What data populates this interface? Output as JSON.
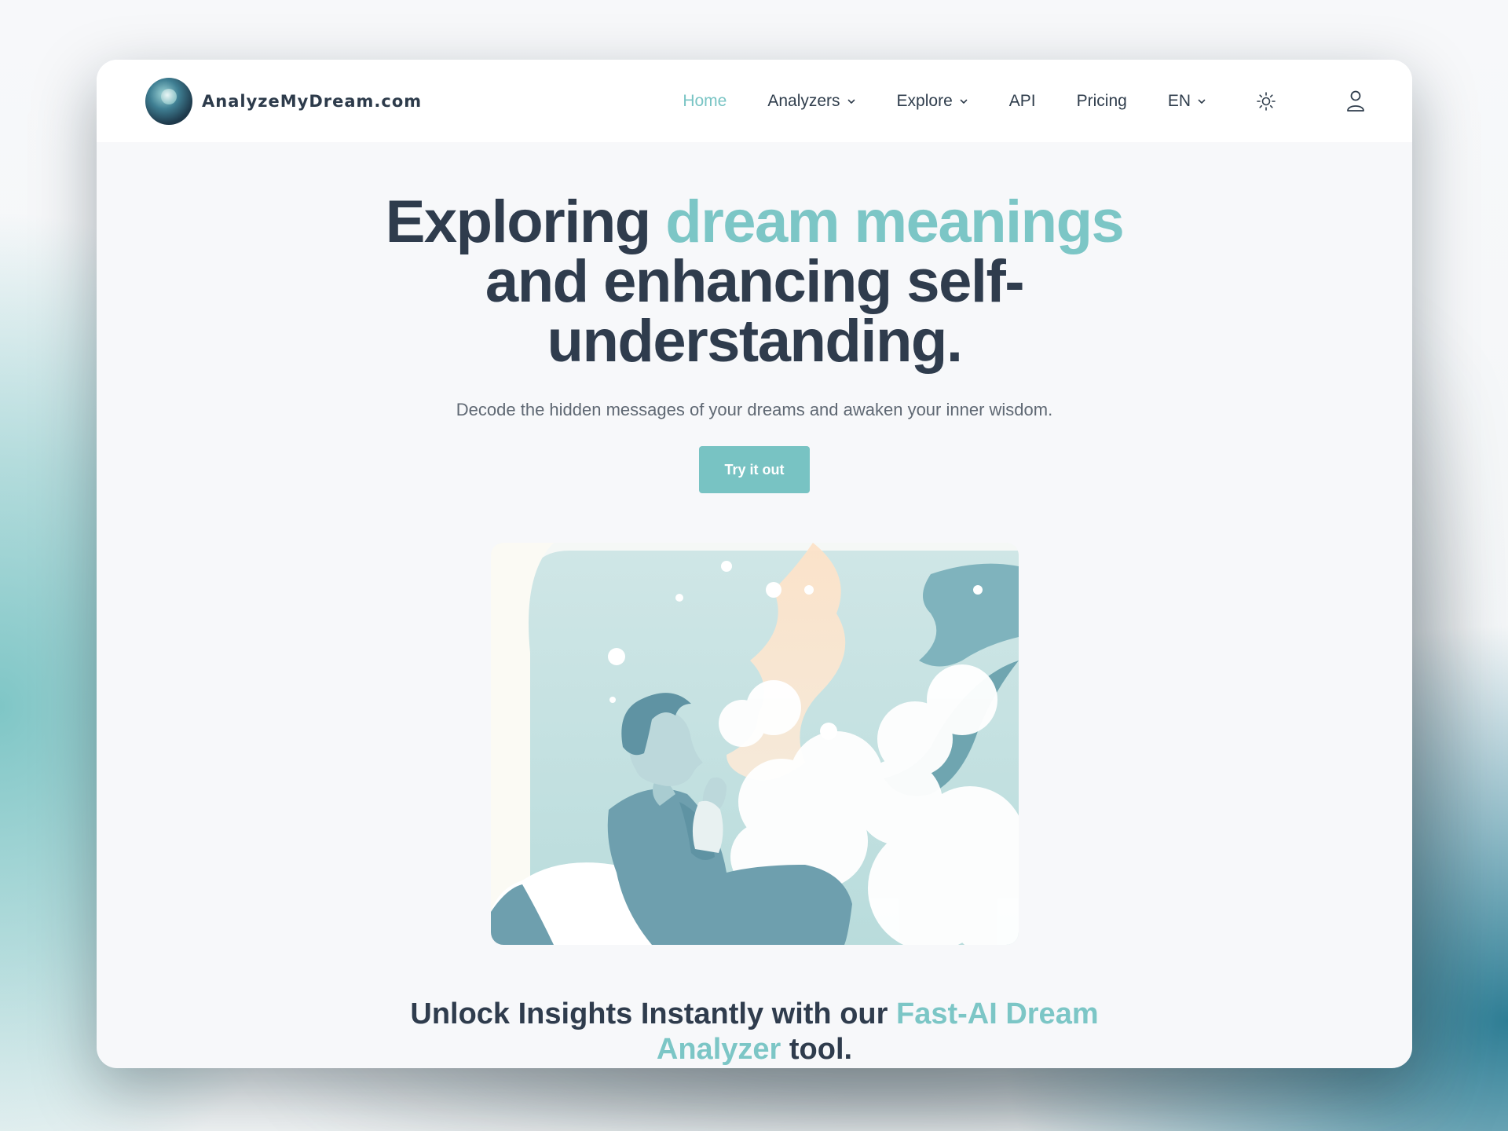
{
  "brand": {
    "name": "AnalyzeMyDream.com"
  },
  "nav": {
    "items": [
      {
        "label": "Home",
        "active": true,
        "dropdown": false
      },
      {
        "label": "Analyzers",
        "active": false,
        "dropdown": true
      },
      {
        "label": "Explore",
        "active": false,
        "dropdown": true
      },
      {
        "label": "API",
        "active": false,
        "dropdown": false
      },
      {
        "label": "Pricing",
        "active": false,
        "dropdown": false
      },
      {
        "label": "EN",
        "active": false,
        "dropdown": true
      }
    ],
    "theme_icon": "sun-icon",
    "account_icon": "user-icon"
  },
  "hero": {
    "headline_part1": "Exploring ",
    "headline_accent": "dream meanings",
    "headline_part2": " and enhancing self-understanding.",
    "subtitle": "Decode the hidden messages of your dreams and awaken your inner wisdom.",
    "cta_label": "Try it out"
  },
  "section": {
    "title_part1": "Unlock Insights Instantly with our ",
    "title_accent": "Fast-AI Dream Analyzer",
    "title_part2": " tool."
  },
  "colors": {
    "accent": "#7cc6c6",
    "text_dark": "#2f3c4d",
    "button": "#78c3c3"
  }
}
